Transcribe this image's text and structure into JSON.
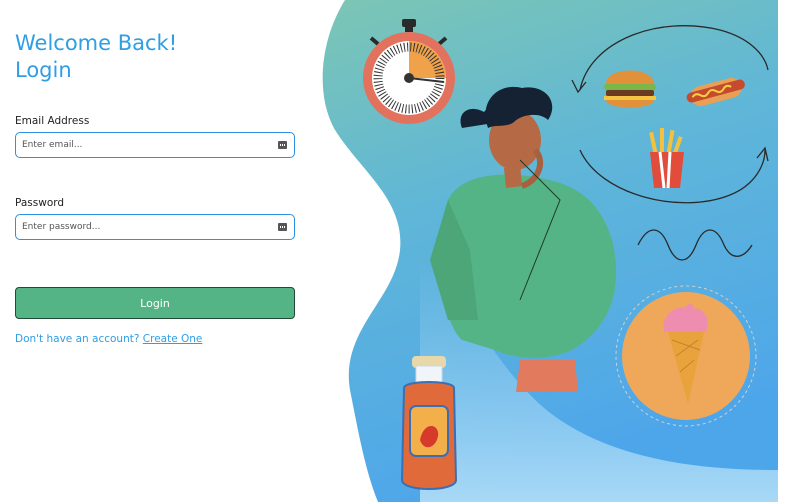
{
  "login": {
    "heading_line1": "Welcome Back!",
    "heading_line2": "Login",
    "email_label": "Email Address",
    "email_placeholder": "Enter email...",
    "password_label": "Password",
    "password_placeholder": "Enter password...",
    "submit_label": "Login",
    "signup_prompt": "Don't have an account?",
    "signup_link": "Create One"
  },
  "colors": {
    "accent": "#2f9ee4",
    "button": "#55b485",
    "panel_top": "#7cc4b8",
    "panel_bottom": "#4fa3e6"
  },
  "illustration": {
    "icons": [
      "stopwatch-icon",
      "burger-icon",
      "hotdog-icon",
      "fries-icon",
      "ice-cream-icon",
      "sauce-bottle-icon",
      "thinking-person"
    ]
  }
}
